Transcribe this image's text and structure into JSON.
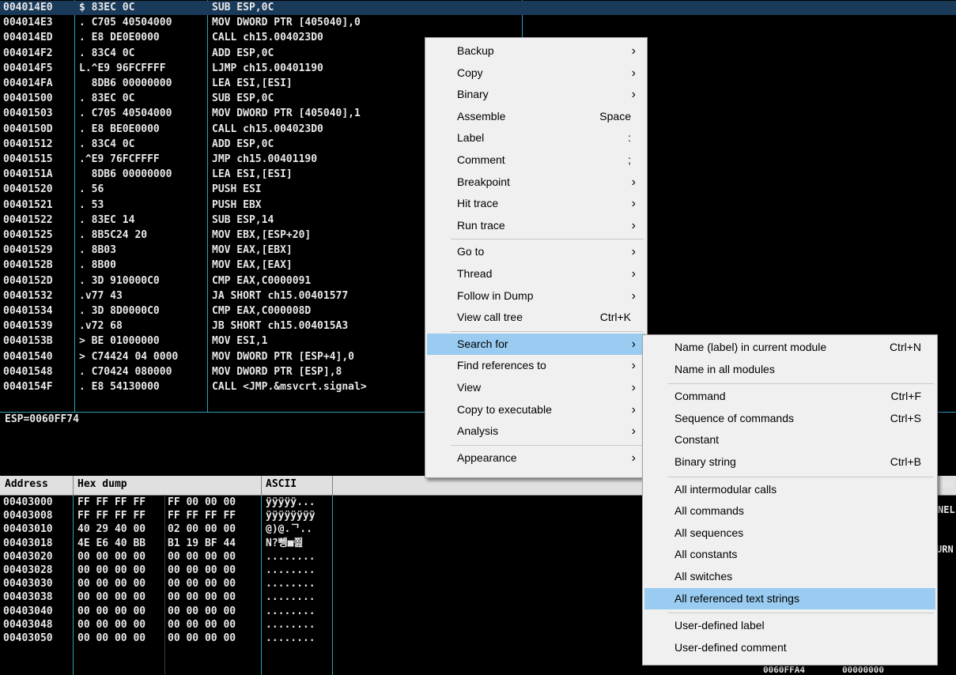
{
  "disasm": {
    "rows": [
      {
        "addr": "004014E0",
        "hex": "$ 83EC 0C",
        "asm": "SUB ESP,0C"
      },
      {
        "addr": "004014E3",
        "hex": ". C705 40504000",
        "asm": "MOV DWORD PTR [405040],0"
      },
      {
        "addr": "004014ED",
        "hex": ". E8 DE0E0000",
        "asm": "CALL ch15.004023D0"
      },
      {
        "addr": "004014F2",
        "hex": ". 83C4 0C",
        "asm": "ADD ESP,0C"
      },
      {
        "addr": "004014F5",
        "hex": "L.^E9 96FCFFFF",
        "asm": "LJMP ch15.00401190"
      },
      {
        "addr": "004014FA",
        "hex": "  8DB6 00000000",
        "asm": "LEA ESI,[ESI]"
      },
      {
        "addr": "00401500",
        "hex": ". 83EC 0C",
        "asm": "SUB ESP,0C"
      },
      {
        "addr": "00401503",
        "hex": ". C705 40504000",
        "asm": "MOV DWORD PTR [405040],1"
      },
      {
        "addr": "0040150D",
        "hex": ". E8 BE0E0000",
        "asm": "CALL ch15.004023D0"
      },
      {
        "addr": "00401512",
        "hex": ". 83C4 0C",
        "asm": "ADD ESP,0C"
      },
      {
        "addr": "00401515",
        "hex": ".^E9 76FCFFFF",
        "asm": "JMP ch15.00401190"
      },
      {
        "addr": "0040151A",
        "hex": "  8DB6 00000000",
        "asm": "LEA ESI,[ESI]"
      },
      {
        "addr": "00401520",
        "hex": ". 56",
        "asm": "PUSH ESI"
      },
      {
        "addr": "00401521",
        "hex": ". 53",
        "asm": "PUSH EBX"
      },
      {
        "addr": "00401522",
        "hex": ". 83EC 14",
        "asm": "SUB ESP,14"
      },
      {
        "addr": "00401525",
        "hex": ". 8B5C24 20",
        "asm": "MOV EBX,[ESP+20]"
      },
      {
        "addr": "00401529",
        "hex": ". 8B03",
        "asm": "MOV EAX,[EBX]"
      },
      {
        "addr": "0040152B",
        "hex": ". 8B00",
        "asm": "MOV EAX,[EAX]"
      },
      {
        "addr": "0040152D",
        "hex": ". 3D 910000C0",
        "asm": "CMP EAX,C0000091"
      },
      {
        "addr": "00401532",
        "hex": ".v77 43",
        "asm": "JA SHORT ch15.00401577"
      },
      {
        "addr": "00401534",
        "hex": ". 3D 8D0000C0",
        "asm": "CMP EAX,C000008D"
      },
      {
        "addr": "00401539",
        "hex": ".v72 68",
        "asm": "JB SHORT ch15.004015A3"
      },
      {
        "addr": "0040153B",
        "hex": "> BE 01000000",
        "asm": "MOV ESI,1"
      },
      {
        "addr": "00401540",
        "hex": "> C74424 04 0000",
        "asm": "MOV DWORD PTR [ESP+4],0"
      },
      {
        "addr": "00401548",
        "hex": ". C70424 080000",
        "asm": "MOV DWORD PTR [ESP],8"
      },
      {
        "addr": "0040154F",
        "hex": ". E8 54130000",
        "asm": "CALL <JMP.&msvcrt.signal>"
      }
    ]
  },
  "info": {
    "text": "ESP=0060FF74"
  },
  "dump": {
    "headers": {
      "address": "Address",
      "hex": "Hex dump",
      "ascii": "ASCII"
    },
    "rows": [
      {
        "addr": "00403000",
        "h1": "FF FF FF FF",
        "h2": "FF 00 00 00",
        "ascii": "ÿÿÿÿÿ..."
      },
      {
        "addr": "00403008",
        "h1": "FF FF FF FF",
        "h2": "FF FF FF FF",
        "ascii": "ÿÿÿÿÿÿÿÿ"
      },
      {
        "addr": "00403010",
        "h1": "40 29 40 00",
        "h2": "02 00 00 00",
        "ascii": "@)@.ᄀ.."
      },
      {
        "addr": "00403018",
        "h1": "4E E6 40 BB",
        "h2": "B1 19 BF 44",
        "ascii": "N?뺑■쬞"
      },
      {
        "addr": "00403020",
        "h1": "00 00 00 00",
        "h2": "00 00 00 00",
        "ascii": "........"
      },
      {
        "addr": "00403028",
        "h1": "00 00 00 00",
        "h2": "00 00 00 00",
        "ascii": "........"
      },
      {
        "addr": "00403030",
        "h1": "00 00 00 00",
        "h2": "00 00 00 00",
        "ascii": "........"
      },
      {
        "addr": "00403038",
        "h1": "00 00 00 00",
        "h2": "00 00 00 00",
        "ascii": "........"
      },
      {
        "addr": "00403040",
        "h1": "00 00 00 00",
        "h2": "00 00 00 00",
        "ascii": "........"
      },
      {
        "addr": "00403048",
        "h1": "00 00 00 00",
        "h2": "00 00 00 00",
        "ascii": "........"
      },
      {
        "addr": "00403050",
        "h1": "00 00 00 00",
        "h2": "00 00 00 00",
        "ascii": "........"
      }
    ],
    "right_fragments": [
      "URN",
      "NEL",
      "URN"
    ],
    "bottom_values": [
      "0060FFA4",
      "00000000"
    ]
  },
  "context_menu": {
    "items": [
      {
        "label": "Backup",
        "shortcut": "",
        "submenu": true
      },
      {
        "label": "Copy",
        "shortcut": "",
        "submenu": true
      },
      {
        "label": "Binary",
        "shortcut": "",
        "submenu": true
      },
      {
        "label": "Assemble",
        "shortcut": "Space",
        "submenu": false
      },
      {
        "label": "Label",
        "shortcut": ":",
        "submenu": false
      },
      {
        "label": "Comment",
        "shortcut": ";",
        "submenu": false
      },
      {
        "label": "Breakpoint",
        "shortcut": "",
        "submenu": true
      },
      {
        "label": "Hit trace",
        "shortcut": "",
        "submenu": true
      },
      {
        "label": "Run trace",
        "shortcut": "",
        "submenu": true
      },
      {
        "label": "Go to",
        "shortcut": "",
        "submenu": true
      },
      {
        "label": "Thread",
        "shortcut": "",
        "submenu": true
      },
      {
        "label": "Follow in Dump",
        "shortcut": "",
        "submenu": true
      },
      {
        "label": "View call tree",
        "shortcut": "Ctrl+K",
        "submenu": false
      },
      {
        "label": "Search for",
        "shortcut": "",
        "submenu": true
      },
      {
        "label": "Find references to",
        "shortcut": "",
        "submenu": true
      },
      {
        "label": "View",
        "shortcut": "",
        "submenu": true
      },
      {
        "label": "Copy to executable",
        "shortcut": "",
        "submenu": true
      },
      {
        "label": "Analysis",
        "shortcut": "",
        "submenu": true
      },
      {
        "label": "Appearance",
        "shortcut": "",
        "submenu": true
      }
    ]
  },
  "search_submenu": {
    "items": [
      {
        "label": "Name (label) in current module",
        "shortcut": "Ctrl+N"
      },
      {
        "label": "Name in all modules",
        "shortcut": ""
      },
      {
        "label": "Command",
        "shortcut": "Ctrl+F"
      },
      {
        "label": "Sequence of commands",
        "shortcut": "Ctrl+S"
      },
      {
        "label": "Constant",
        "shortcut": ""
      },
      {
        "label": "Binary string",
        "shortcut": "Ctrl+B"
      },
      {
        "label": "All intermodular calls",
        "shortcut": ""
      },
      {
        "label": "All commands",
        "shortcut": ""
      },
      {
        "label": "All sequences",
        "shortcut": ""
      },
      {
        "label": "All constants",
        "shortcut": ""
      },
      {
        "label": "All switches",
        "shortcut": ""
      },
      {
        "label": "All referenced text strings",
        "shortcut": ""
      },
      {
        "label": "User-defined label",
        "shortcut": ""
      },
      {
        "label": "User-defined comment",
        "shortcut": ""
      }
    ]
  },
  "colors": {
    "accent_line": "#2aa3b5",
    "menu_highlight": "#99ccf0",
    "menu_bg": "#f0f0f0"
  }
}
